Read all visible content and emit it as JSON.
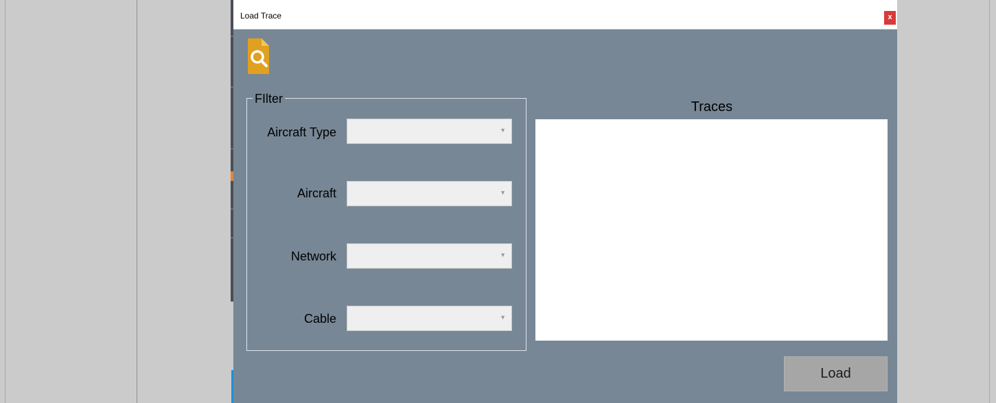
{
  "dialog": {
    "title": "Load Trace",
    "close_label": "x",
    "icon": "document-search-icon",
    "accent_color": "#e0a020",
    "background_color": "#778796"
  },
  "filter": {
    "legend": "FIlter",
    "fields": [
      {
        "label": "Aircraft Type",
        "value": ""
      },
      {
        "label": "Aircraft",
        "value": ""
      },
      {
        "label": "Network",
        "value": ""
      },
      {
        "label": "Cable",
        "value": ""
      }
    ]
  },
  "traces": {
    "heading": "Traces",
    "items": []
  },
  "actions": {
    "load_label": "Load"
  }
}
